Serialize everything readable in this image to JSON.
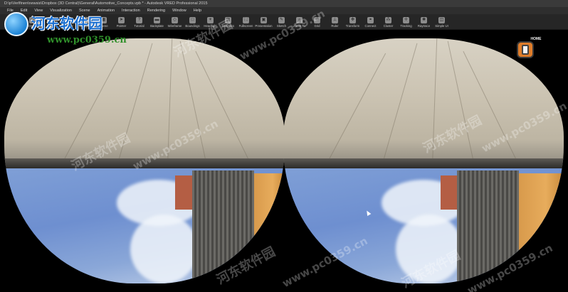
{
  "window": {
    "title": "D:\\p\\Verlfinen\\newsis\\Dropbox (3D Central)\\General\\Automotive_Concepts.vpb * - Autodesk VRED Professional 2015"
  },
  "menu": [
    {
      "label": "File"
    },
    {
      "label": "Edit"
    },
    {
      "label": "View"
    },
    {
      "label": "Visualization"
    },
    {
      "label": "Scene"
    },
    {
      "label": "Animation"
    },
    {
      "label": "Interaction"
    },
    {
      "label": "Rendering"
    },
    {
      "label": "Window"
    },
    {
      "label": "Help"
    }
  ],
  "toolbar": [
    {
      "label": "New",
      "icon": "new-file-icon"
    },
    {
      "label": "Open",
      "icon": "folder-icon"
    },
    {
      "label": "Save",
      "icon": "save-icon"
    },
    {
      "label": "Render",
      "icon": "render-icon"
    },
    {
      "label": "Viewpoint",
      "icon": "camera-icon"
    },
    {
      "label": "Scene",
      "icon": "scene-icon"
    },
    {
      "label": "Pointer",
      "icon": "pointer-icon"
    },
    {
      "label": "Tutorial",
      "icon": "tutorial-icon"
    },
    {
      "label": "Backplate",
      "icon": "backplate-icon"
    },
    {
      "label": "Wireframe",
      "icon": "wireframe-icon"
    },
    {
      "label": "Boundings",
      "icon": "boundings-icon"
    },
    {
      "label": "Headlight",
      "icon": "headlight-icon"
    },
    {
      "label": "Statistics",
      "icon": "statistics-icon"
    },
    {
      "label": "Fullscreen",
      "icon": "fullscreen-icon"
    },
    {
      "label": "Presentation",
      "icon": "presentation-icon"
    },
    {
      "label": "Sketch",
      "icon": "sketch-icon"
    },
    {
      "label": "Zoom To",
      "icon": "zoom-icon"
    },
    {
      "label": "Grid",
      "icon": "grid-icon"
    },
    {
      "label": "Ruler",
      "icon": "ruler-icon"
    },
    {
      "label": "Transform",
      "icon": "transform-icon"
    },
    {
      "label": "Connect",
      "icon": "connect-icon"
    },
    {
      "label": "Cluster",
      "icon": "cluster-icon"
    },
    {
      "label": "Tracking",
      "icon": "tracking-icon"
    },
    {
      "label": "Raytrace",
      "icon": "raytrace-icon"
    },
    {
      "label": "Simple UI",
      "icon": "simple-ui-icon"
    }
  ],
  "home_widget": {
    "label": "HOME"
  },
  "watermark": {
    "logo_text": "河东软件园",
    "url": "www.pc0359.cn",
    "repeat_text": "河东软件园",
    "repeat_url": "www.pc0359.cn"
  },
  "colors": {
    "menu_bg": "#2e2e2e",
    "toolbar_bg": "#262626",
    "home_orange": "#e07d2a",
    "logo_blue": "#1b6fd0",
    "logo_green": "#2f8f2a"
  }
}
